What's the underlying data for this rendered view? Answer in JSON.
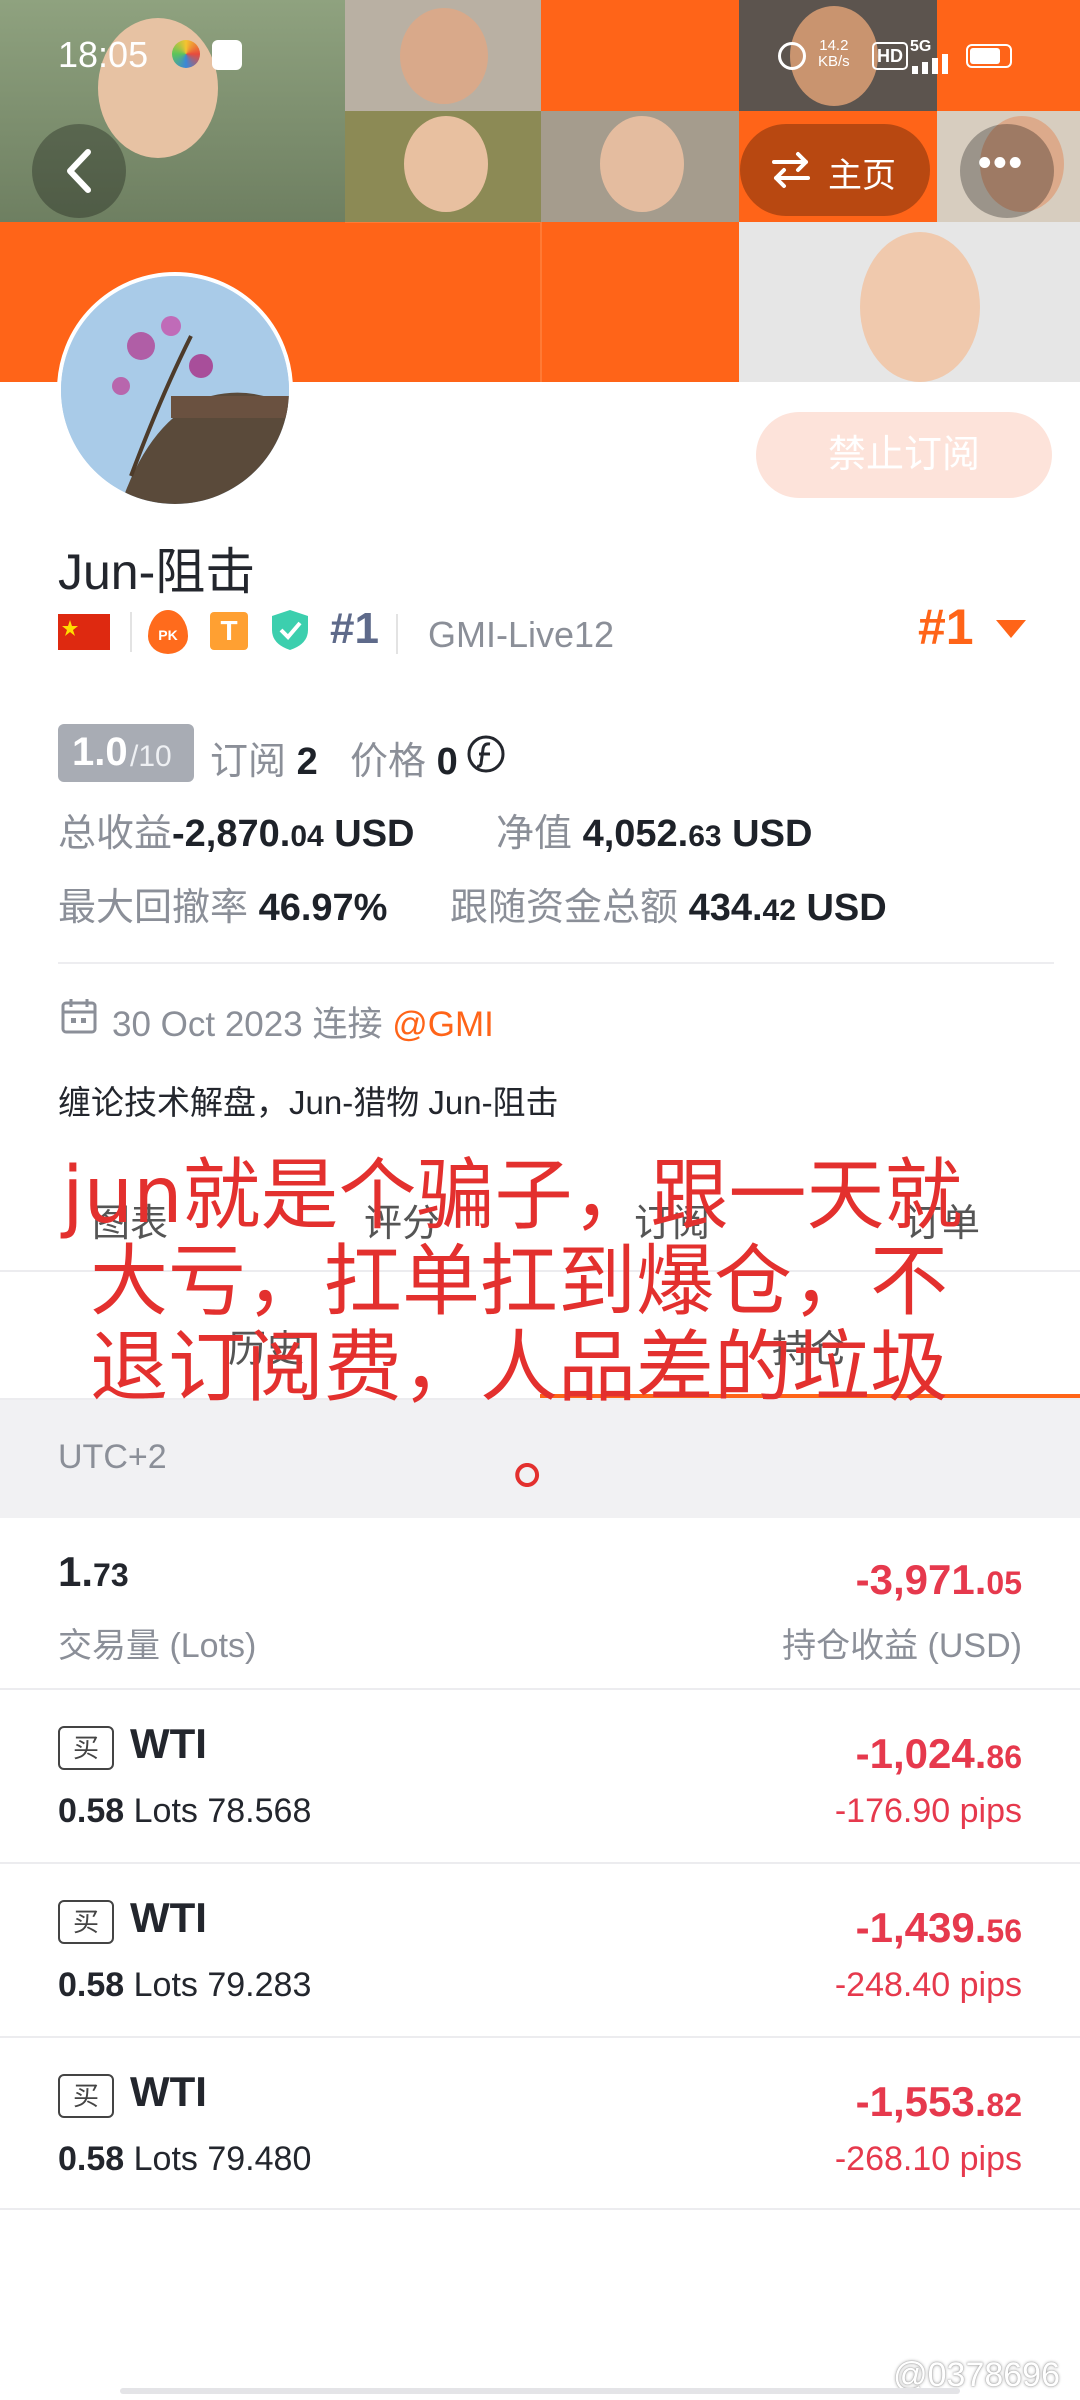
{
  "status_bar": {
    "time": "18:05",
    "speed_value": "14.2",
    "speed_unit": "KB/s",
    "hd": "HD",
    "network": "5G"
  },
  "header": {
    "home_label": "主页",
    "more_label": "•••"
  },
  "profile": {
    "name": "Jun-阻击",
    "rank": "#1",
    "server": "GMI-Live12",
    "rank_right": "#1",
    "ban_button": "禁止订阅",
    "badge_pk": "PK",
    "badge_t": "T"
  },
  "stats": {
    "score": "1.0",
    "score_max": "/10",
    "subscribe_label": "订阅",
    "subscribe_count": "2",
    "price_label": "价格",
    "price_value": "0",
    "total_profit_label": "总收益",
    "total_profit_main": "-2,870.",
    "total_profit_dec": "04",
    "total_profit_unit": "USD",
    "net_value_label": "净值",
    "net_value_main": "4,052.",
    "net_value_dec": "63",
    "net_value_unit": "USD",
    "max_drawdown_label": "最大回撤率",
    "max_drawdown_value": "46.97%",
    "follow_funds_label": "跟随资金总额",
    "follow_funds_main": "434.",
    "follow_funds_dec": "42",
    "follow_funds_unit": "USD"
  },
  "connection": {
    "date": "30 Oct 2023",
    "connect_label": "连接",
    "broker": "@GMI"
  },
  "description": "缠论技术解盘，Jun-猎物 Jun-阻击",
  "tabs": [
    {
      "label": "图表"
    },
    {
      "label": "评分"
    },
    {
      "label": "订阅"
    },
    {
      "label": "订单"
    }
  ],
  "subtabs": [
    {
      "label": "历史"
    },
    {
      "label": "持仓"
    }
  ],
  "overlay": {
    "line1": "jun就是个骗子，跟一天就",
    "line2": "大亏，扛单扛到爆仓，不",
    "line3": "退订阅费，人品差的垃圾",
    "line4": "。"
  },
  "timezone": "UTC+2",
  "summary": {
    "volume_main": "1.",
    "volume_dec": "73",
    "volume_label": "交易量 (Lots)",
    "position_profit_main": "-3,971.",
    "position_profit_dec": "05",
    "position_profit_label": "持仓收益 (USD)"
  },
  "orders": [
    {
      "side": "买",
      "symbol": "WTI",
      "lots": "0.58",
      "lots_unit": "Lots",
      "price": "78.568",
      "pnl_main": "-1,024.",
      "pnl_dec": "86",
      "pips": "-176.90 pips"
    },
    {
      "side": "买",
      "symbol": "WTI",
      "lots": "0.58",
      "lots_unit": "Lots",
      "price": "79.283",
      "pnl_main": "-1,439.",
      "pnl_dec": "56",
      "pips": "-248.40 pips"
    },
    {
      "side": "买",
      "symbol": "WTI",
      "lots": "0.58",
      "lots_unit": "Lots",
      "price": "79.480",
      "pnl_main": "-1,553.",
      "pnl_dec": "82",
      "pips": "-268.10 pips"
    }
  ],
  "watermark": "@0378696"
}
